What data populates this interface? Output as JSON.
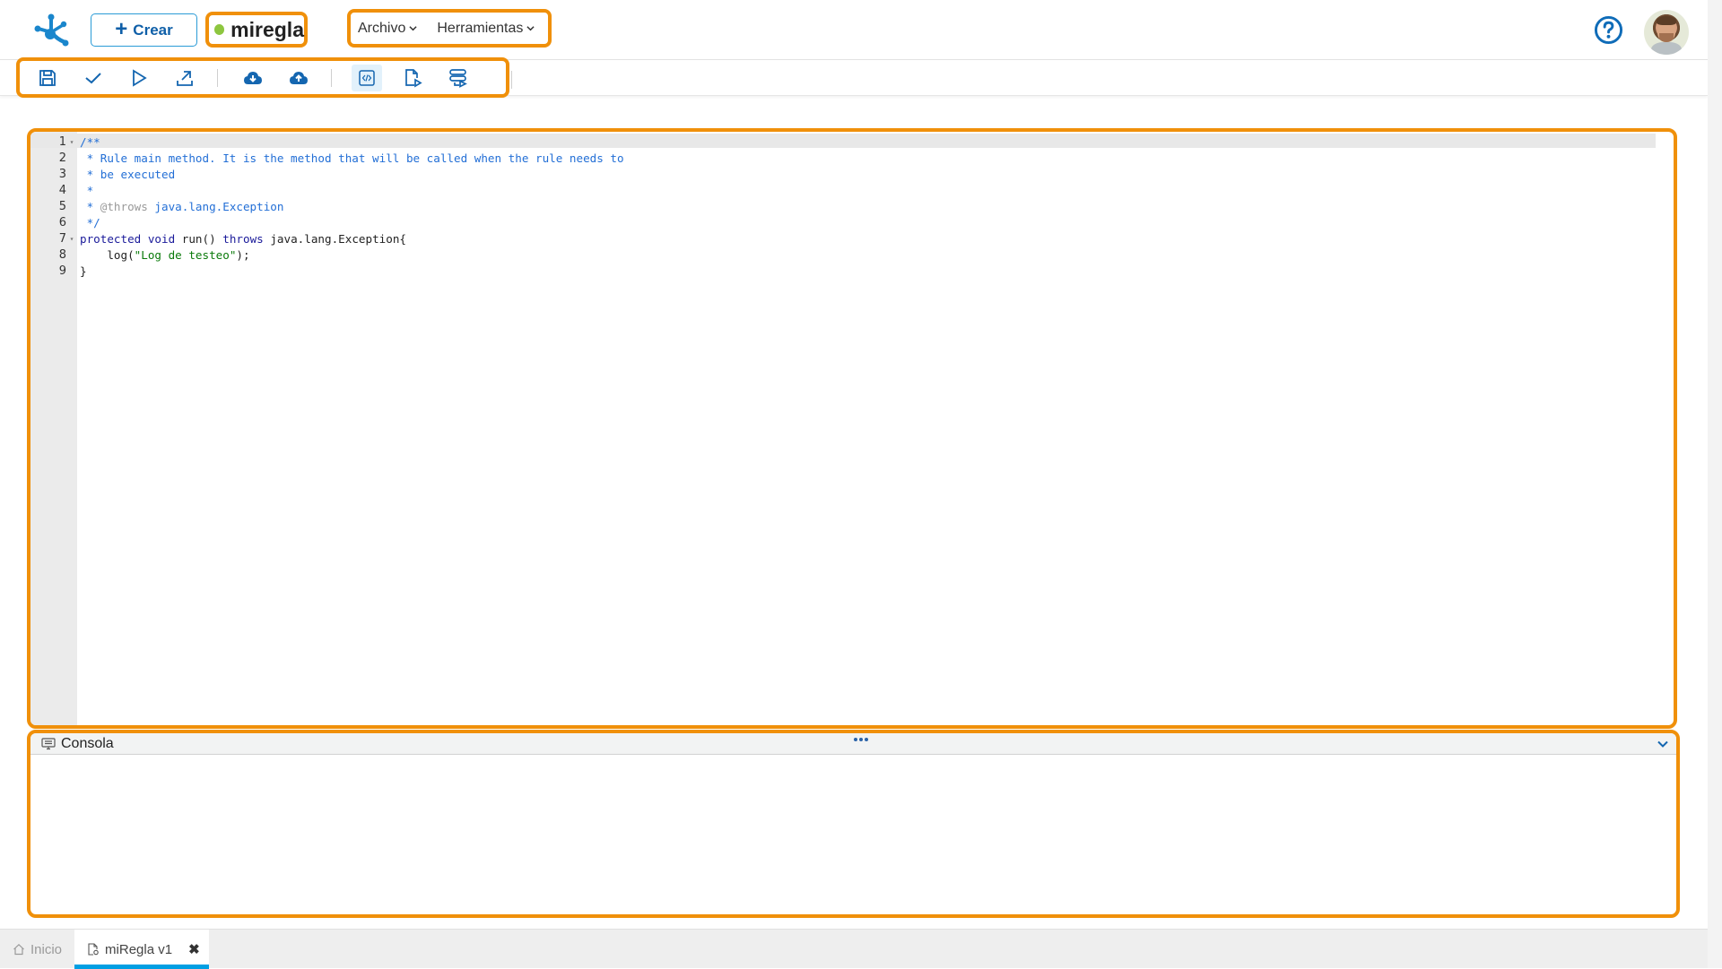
{
  "header": {
    "create_label": "Crear",
    "rule_name": "miregla",
    "rule_status_color": "#8dc63f",
    "menus": [
      {
        "label": "Archivo"
      },
      {
        "label": "Herramientas"
      }
    ],
    "help_icon": "help-circle-icon",
    "avatar": "user-avatar"
  },
  "toolbar": {
    "buttons": [
      {
        "icon": "save-icon",
        "title": "Guardar"
      },
      {
        "icon": "check-icon",
        "title": "Validar"
      },
      {
        "icon": "play-icon",
        "title": "Ejecutar"
      },
      {
        "icon": "export-icon",
        "title": "Exportar"
      },
      {
        "icon": "cloud-download-icon",
        "title": "Descargar"
      },
      {
        "icon": "cloud-upload-icon",
        "title": "Subir"
      },
      {
        "icon": "code-icon",
        "title": "Código",
        "active": true
      },
      {
        "icon": "file-run-icon",
        "title": "Ejecutar archivo"
      },
      {
        "icon": "list-run-icon",
        "title": "Ejecutar lista"
      }
    ]
  },
  "editor": {
    "lines": [
      {
        "n": "1",
        "fold": true,
        "text": "/**"
      },
      {
        "n": "2",
        "fold": false,
        "text": " * Rule main method. It is the method that will be called when the rule needs to"
      },
      {
        "n": "3",
        "fold": false,
        "text": " * be executed"
      },
      {
        "n": "4",
        "fold": false,
        "text": " *"
      },
      {
        "n": "5",
        "fold": false,
        "tag": "@throws",
        "text": " java.lang.Exception"
      },
      {
        "n": "6",
        "fold": false,
        "text": " */"
      },
      {
        "n": "7",
        "fold": true,
        "text": "protected void run() throws java.lang.Exception{"
      },
      {
        "n": "8",
        "fold": false,
        "text": "    log(\"Log de testeo\");"
      },
      {
        "n": "9",
        "fold": false,
        "text": "}"
      }
    ],
    "code": {
      "l2": " * Rule main method. It is the method that will be called when the rule needs to",
      "l3": " * be executed",
      "l4": " *",
      "l5_star": " * ",
      "l5_tag": "@throws",
      "l5_rest": " java.lang.Exception",
      "l6": " */",
      "l1": "/**",
      "l7_kw1": "protected",
      "l7_kw2": "void",
      "l7_mid": " run() ",
      "l7_kw3": "throws",
      "l7_rest": " java.lang.Exception{",
      "l8_pre": "    log(",
      "l8_str": "\"Log de testeo\"",
      "l8_post": ");",
      "l9": "}"
    }
  },
  "console": {
    "title": "Consola"
  },
  "tabs": [
    {
      "label": "Inicio",
      "active": false
    },
    {
      "label": "miRegla v1",
      "active": true
    }
  ]
}
